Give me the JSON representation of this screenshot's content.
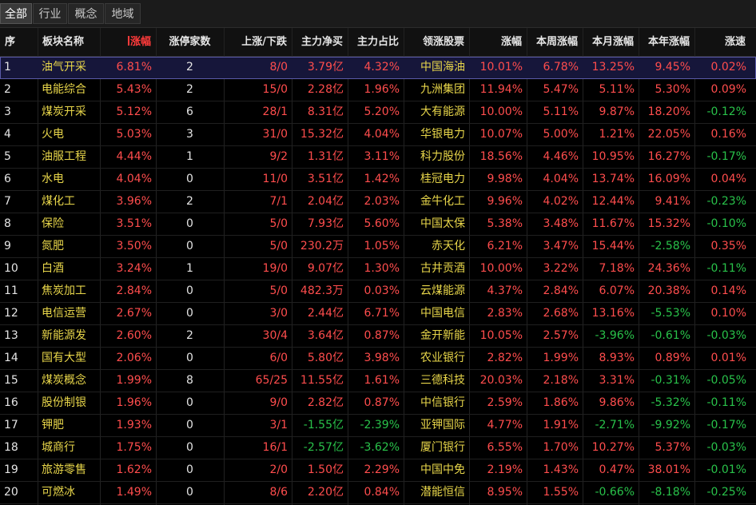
{
  "tabs": [
    "全部",
    "行业",
    "概念",
    "地域"
  ],
  "active_tab": 0,
  "headers": [
    "序",
    "板块名称",
    "涨幅",
    "涨停家数",
    "上涨/下跌",
    "主力净买",
    "主力占比",
    "领涨股票",
    "涨幅",
    "本周涨幅",
    "本月涨幅",
    "本年涨幅",
    "涨速"
  ],
  "sorted_column": 2,
  "colors": {
    "up": "#ff4d4d",
    "down": "#29c24a",
    "name": "#e8d64a",
    "selected_row": "#16163a"
  },
  "rows": [
    [
      "1",
      "油气开采",
      "6.81%",
      "2",
      "8/0",
      "3.79亿",
      "4.32%",
      "中国海油",
      "10.01%",
      "6.78%",
      "13.25%",
      "9.45%",
      "0.02%"
    ],
    [
      "2",
      "电能综合",
      "5.43%",
      "2",
      "15/0",
      "2.28亿",
      "1.96%",
      "九洲集团",
      "11.94%",
      "5.47%",
      "5.11%",
      "5.30%",
      "0.09%"
    ],
    [
      "3",
      "煤炭开采",
      "5.12%",
      "6",
      "28/1",
      "8.31亿",
      "5.20%",
      "大有能源",
      "10.00%",
      "5.11%",
      "9.87%",
      "18.20%",
      "-0.12%"
    ],
    [
      "4",
      "火电",
      "5.03%",
      "3",
      "31/0",
      "15.32亿",
      "4.04%",
      "华银电力",
      "10.07%",
      "5.00%",
      "1.21%",
      "22.05%",
      "0.16%"
    ],
    [
      "5",
      "油服工程",
      "4.44%",
      "1",
      "9/2",
      "1.31亿",
      "3.11%",
      "科力股份",
      "18.56%",
      "4.46%",
      "10.95%",
      "16.27%",
      "-0.17%"
    ],
    [
      "6",
      "水电",
      "4.04%",
      "0",
      "11/0",
      "3.51亿",
      "1.42%",
      "桂冠电力",
      "9.98%",
      "4.04%",
      "13.74%",
      "16.09%",
      "0.04%"
    ],
    [
      "7",
      "煤化工",
      "3.96%",
      "2",
      "7/1",
      "2.04亿",
      "2.03%",
      "金牛化工",
      "9.96%",
      "4.02%",
      "12.44%",
      "9.41%",
      "-0.23%"
    ],
    [
      "8",
      "保险",
      "3.51%",
      "0",
      "5/0",
      "7.93亿",
      "5.60%",
      "中国太保",
      "5.38%",
      "3.48%",
      "11.67%",
      "15.32%",
      "-0.10%"
    ],
    [
      "9",
      "氮肥",
      "3.50%",
      "0",
      "5/0",
      "230.2万",
      "1.05%",
      "赤天化",
      "6.21%",
      "3.47%",
      "15.44%",
      "-2.58%",
      "0.35%"
    ],
    [
      "10",
      "白酒",
      "3.24%",
      "1",
      "19/0",
      "9.07亿",
      "1.30%",
      "古井贡酒",
      "10.00%",
      "3.22%",
      "7.18%",
      "24.36%",
      "-0.11%"
    ],
    [
      "11",
      "焦炭加工",
      "2.84%",
      "0",
      "5/0",
      "482.3万",
      "0.03%",
      "云煤能源",
      "4.37%",
      "2.84%",
      "6.07%",
      "20.38%",
      "0.14%"
    ],
    [
      "12",
      "电信运营",
      "2.67%",
      "0",
      "3/0",
      "2.44亿",
      "6.71%",
      "中国电信",
      "2.83%",
      "2.68%",
      "13.16%",
      "-5.53%",
      "0.10%"
    ],
    [
      "13",
      "新能源发",
      "2.60%",
      "2",
      "30/4",
      "3.64亿",
      "0.87%",
      "金开新能",
      "10.05%",
      "2.57%",
      "-3.96%",
      "-0.61%",
      "-0.03%"
    ],
    [
      "14",
      "国有大型",
      "2.06%",
      "0",
      "6/0",
      "5.80亿",
      "3.98%",
      "农业银行",
      "2.82%",
      "1.99%",
      "8.93%",
      "0.89%",
      "0.01%"
    ],
    [
      "15",
      "煤炭概念",
      "1.99%",
      "8",
      "65/25",
      "11.55亿",
      "1.61%",
      "三德科技",
      "20.03%",
      "2.18%",
      "3.31%",
      "-0.31%",
      "-0.05%"
    ],
    [
      "16",
      "股份制银",
      "1.96%",
      "0",
      "9/0",
      "2.82亿",
      "0.87%",
      "中信银行",
      "2.59%",
      "1.86%",
      "9.86%",
      "-5.32%",
      "-0.11%"
    ],
    [
      "17",
      "钾肥",
      "1.93%",
      "0",
      "3/1",
      "-1.55亿",
      "-2.39%",
      "亚钾国际",
      "4.77%",
      "1.91%",
      "-2.71%",
      "-9.92%",
      "-0.17%"
    ],
    [
      "18",
      "城商行",
      "1.75%",
      "0",
      "16/1",
      "-2.57亿",
      "-3.62%",
      "厦门银行",
      "6.55%",
      "1.70%",
      "10.27%",
      "5.37%",
      "-0.03%"
    ],
    [
      "19",
      "旅游零售",
      "1.62%",
      "0",
      "2/0",
      "1.50亿",
      "2.29%",
      "中国中免",
      "2.19%",
      "1.43%",
      "0.47%",
      "38.01%",
      "-0.01%"
    ],
    [
      "20",
      "可燃冰",
      "1.49%",
      "0",
      "8/6",
      "2.20亿",
      "0.84%",
      "潜能恒信",
      "8.95%",
      "1.55%",
      "-0.66%",
      "-8.18%",
      "-0.25%"
    ]
  ]
}
